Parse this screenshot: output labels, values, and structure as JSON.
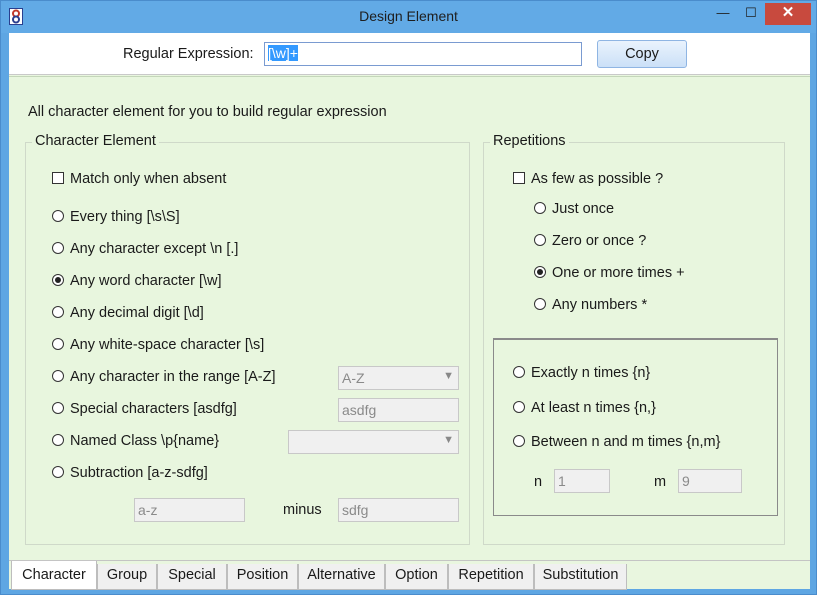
{
  "window": {
    "title": "Design Element",
    "app_icon": "app-icon",
    "min_icon": "—",
    "max_icon": "☐",
    "close_icon": "✕"
  },
  "top": {
    "regex_label": "Regular Expression:",
    "regex_value": "[\\w]+",
    "copy_label": "Copy"
  },
  "panel": {
    "description": "All character element for you to build regular expression"
  },
  "character": {
    "title": "Character Element",
    "match_absent": "Match only when absent",
    "options": [
      "Every thing  [\\s\\S]",
      "Any character except \\n  [.]",
      "Any word character  [\\w]",
      "Any decimal digit  [\\d]",
      "Any white-space character  [\\s]",
      "Any character in the range [A-Z]",
      "Special characters  [asdfg]",
      "Named Class \\p{name}",
      "Subtraction  [a-z-sdfg]"
    ],
    "selected_index": 2,
    "range_value": "A-Z",
    "special_value": "asdfg",
    "named_value": "",
    "sub_from": "a-z",
    "minus_label": "minus",
    "sub_minus": "sdfg"
  },
  "repetitions": {
    "title": "Repetitions",
    "few_label": "As few as possible  ?",
    "options": [
      "Just once",
      "Zero or once  ?",
      "One or more times  +",
      "Any numbers  *"
    ],
    "selected_index": 2,
    "count_options": [
      "Exactly n times  {n}",
      "At least n times  {n,}",
      "Between n and m times {n,m}"
    ],
    "n_label": "n",
    "n_value": "1",
    "m_label": "m",
    "m_value": "9"
  },
  "tabs": [
    "Character",
    "Group",
    "Special",
    "Position",
    "Alternative",
    "Option",
    "Repetition",
    "Substitution"
  ],
  "active_tab": "Character",
  "colors": {
    "title_bar": "#62aae6",
    "panel_bg": "#e8f6de",
    "close_button": "#c84a3e",
    "selection": "#3399ff"
  }
}
